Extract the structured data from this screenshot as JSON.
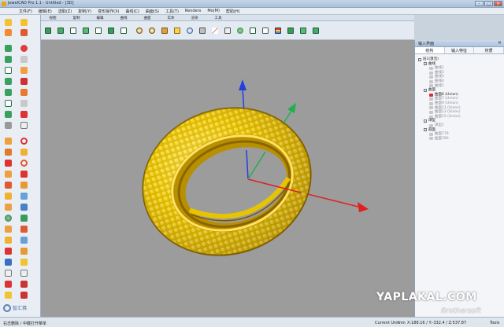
{
  "window": {
    "title": "JewelCAD Pro 1.1 - Untitled - [3D]"
  },
  "menubar": {
    "items": [
      "文件(F)",
      "编辑(E)",
      "选取(Z)",
      "复制(Y)",
      "变形操作(X)",
      "曲线(C)",
      "曲面(S)",
      "工具(T)",
      "Renders",
      "Mo(M)",
      "帮助(H)"
    ]
  },
  "tabs": [
    "视图",
    "复制",
    "编辑",
    "曲线",
    "曲面",
    "实体",
    "渲染",
    "工具"
  ],
  "right_panel": {
    "title": "输入界面",
    "tabs": [
      "结构",
      "输入特征",
      "材质"
    ],
    "tree": [
      {
        "level": 0,
        "label": "层1(激活)",
        "dim": false,
        "toggle": "-"
      },
      {
        "level": 1,
        "label": "曲线",
        "dim": false,
        "toggle": "-"
      },
      {
        "level": 2,
        "label": "曲线1",
        "dim": true
      },
      {
        "level": 2,
        "label": "曲线2",
        "dim": true
      },
      {
        "level": 2,
        "label": "曲线3",
        "dim": true
      },
      {
        "level": 2,
        "label": "曲线4",
        "dim": true
      },
      {
        "level": 2,
        "label": "曲线5",
        "dim": true
      },
      {
        "level": 1,
        "label": "曲面",
        "dim": false,
        "toggle": "-"
      },
      {
        "level": 2,
        "label": "曲面6 (Union)",
        "dim": false
      },
      {
        "level": 2,
        "label": "曲面7 (Union)",
        "dim": true
      },
      {
        "level": 2,
        "label": "曲面9 (Union)",
        "dim": true
      },
      {
        "level": 2,
        "label": "曲面11 (Union)",
        "dim": true
      },
      {
        "level": 2,
        "label": "曲面13 (Union)",
        "dim": true
      },
      {
        "level": 2,
        "label": "曲面15 (Union)",
        "dim": true
      },
      {
        "level": 1,
        "label": "球型",
        "dim": false,
        "toggle": "-"
      },
      {
        "level": 2,
        "label": "球型1",
        "dim": true
      },
      {
        "level": 1,
        "label": "圆面",
        "dim": false,
        "toggle": "-"
      },
      {
        "level": 2,
        "label": "曲面779",
        "dim": true
      },
      {
        "level": 2,
        "label": "曲面780",
        "dim": true
      }
    ]
  },
  "statusbar": {
    "left": "右击删除 / 中键打开菜单",
    "unit_label": "Current Unit:",
    "unit": "mm",
    "coords": "X:188.16 / Y:-332.4 / Z:537.87",
    "tools": "Tools"
  },
  "watermark": {
    "site": "YAPLAKAL.COM",
    "brand": "Brothersoft",
    "logo_text": "智汇佛"
  },
  "colors": {
    "gold": "#e5c300",
    "viewport_bg": "#9c9c9c",
    "axis_x": "#e02020",
    "axis_y": "#20b050",
    "axis_z": "#2040e0"
  }
}
